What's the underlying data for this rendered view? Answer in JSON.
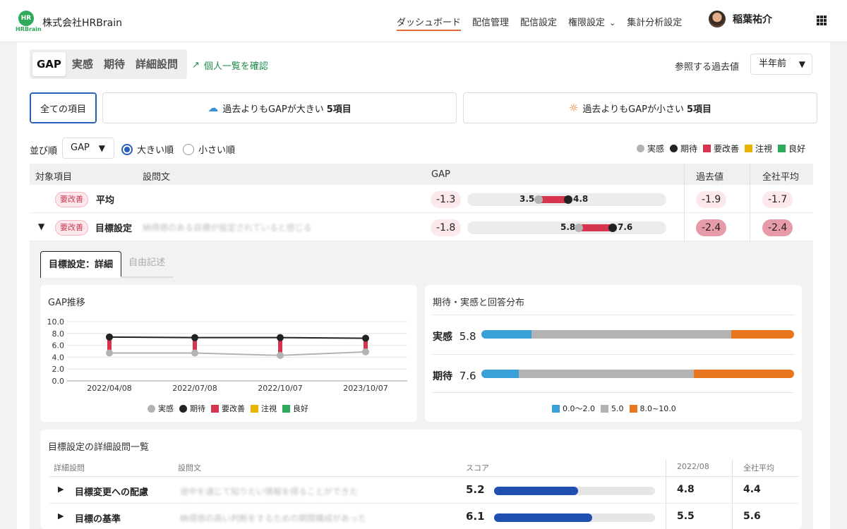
{
  "header": {
    "logo_text": "HR",
    "logo_sub": "HRBrain",
    "company": "株式会社HRBrain",
    "nav": [
      {
        "label": "ダッシュボード",
        "active": true
      },
      {
        "label": "配信管理"
      },
      {
        "label": "配信設定"
      },
      {
        "label": "権限設定"
      },
      {
        "label": "集計分析設定"
      }
    ],
    "username": "稲葉祐介"
  },
  "view_tabs": [
    "GAP",
    "実感",
    "期待",
    "詳細設問"
  ],
  "personal_link": "個人一覧を確認",
  "past": {
    "label": "参照する過去値",
    "selected": "半年前"
  },
  "filters": {
    "all": "全ての項目",
    "larger": {
      "text": "過去よりもGAPが大きい",
      "count": "5項目"
    },
    "smaller": {
      "text": "過去よりもGAPが小さい",
      "count": "5項目"
    }
  },
  "sort": {
    "label": "並び順",
    "selected": "GAP",
    "options": [
      "大きい順",
      "小さい順"
    ]
  },
  "legend": [
    {
      "label": "実感",
      "color": "#b3b3b3",
      "shape": "dot"
    },
    {
      "label": "期待",
      "color": "#222222",
      "shape": "dot"
    },
    {
      "label": "要改善",
      "color": "#d7344f",
      "shape": "square"
    },
    {
      "label": "注視",
      "color": "#e8b400",
      "shape": "square"
    },
    {
      "label": "良好",
      "color": "#2eab5a",
      "shape": "square"
    }
  ],
  "table_headers": {
    "item": "対象項目",
    "question": "設問文",
    "gap": "GAP",
    "past": "過去値",
    "company_avg": "全社平均"
  },
  "rows": [
    {
      "badge": "要改善",
      "name": "平均",
      "question": "",
      "gap": "-1.3",
      "real": 3.5,
      "expect": 4.8,
      "real_label": "3.5",
      "expect_label": "4.8",
      "past": "-1.9",
      "avg": "-1.7"
    },
    {
      "badge": "要改善",
      "name": "目標設定",
      "question": "納得感のある目標が設定されていると感じる",
      "gap": "-1.8",
      "real": 5.8,
      "expect": 7.6,
      "real_label": "5.8",
      "expect_label": "7.6",
      "past": "-2.4",
      "avg": "-2.4"
    }
  ],
  "detail_tabs": [
    "目標設定：詳細",
    "自由記述"
  ],
  "gap_trend": {
    "title": "GAP推移",
    "legend": [
      "実感",
      "期待",
      "要改善",
      "注視",
      "良好"
    ]
  },
  "chart_data": {
    "type": "line",
    "title": "GAP推移",
    "x": [
      "2022/04/08",
      "2022/07/08",
      "2022/10/07",
      "2023/10/07"
    ],
    "ylim": [
      0,
      10
    ],
    "yticks": [
      "0.0",
      "2.0",
      "4.0",
      "6.0",
      "8.0",
      "10.0"
    ],
    "series": [
      {
        "name": "実感",
        "values": [
          4.7,
          4.7,
          4.3,
          4.9
        ]
      },
      {
        "name": "期待",
        "values": [
          7.4,
          7.3,
          7.3,
          7.2
        ]
      }
    ]
  },
  "distribution": {
    "title": "期待・実感と回答分布",
    "rows": [
      {
        "label": "実感",
        "value": "5.8",
        "segments": [
          0.16,
          0.64,
          0.2
        ]
      },
      {
        "label": "期待",
        "value": "7.6",
        "segments": [
          0.12,
          0.56,
          0.32
        ]
      }
    ],
    "legend": [
      {
        "label": "0.0〜2.0",
        "color": "#3aa0d8"
      },
      {
        "label": "5.0",
        "color": "#b3b3b3"
      },
      {
        "label": "8.0~10.0",
        "color": "#e8761e"
      }
    ]
  },
  "detail_list": {
    "title": "目標設定の詳細設問一覧",
    "headers": {
      "item": "詳細設問",
      "question": "設問文",
      "score": "スコア",
      "past": "2022/08",
      "avg": "全社平均"
    },
    "rows": [
      {
        "name": "目標変更への配慮",
        "question": "途中を通じて知りたい情報を得ることができた",
        "score": "5.2",
        "score_value": 5.2,
        "past": "4.8",
        "avg": "4.4"
      },
      {
        "name": "目標の基準",
        "question": "納得感の高い判断をするための期間構成があった",
        "score": "6.1",
        "score_value": 6.1,
        "past": "5.5",
        "avg": "5.6"
      }
    ]
  }
}
